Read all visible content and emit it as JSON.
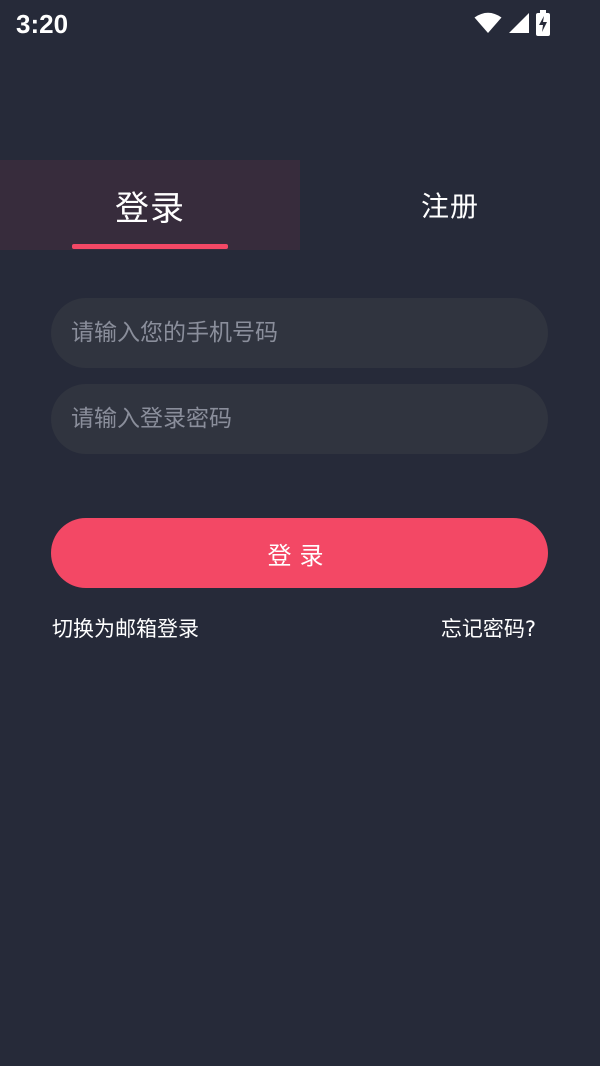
{
  "status_bar": {
    "time": "3:20",
    "icons": [
      "wifi-icon",
      "cellular-signal-icon",
      "battery-charging-icon"
    ]
  },
  "tabs": {
    "login_label": "登录",
    "register_label": "注册",
    "active": "login"
  },
  "form": {
    "phone_placeholder": "请输入您的手机号码",
    "password_placeholder": "请输入登录密码",
    "submit_label": "登录"
  },
  "links": {
    "switch_email": "切换为邮箱登录",
    "forgot_password": "忘记密码?"
  },
  "colors": {
    "background": "#262a39",
    "accent": "#f34865",
    "input_background": "#30343f",
    "active_tab_background": "#372c3c",
    "placeholder": "#8a8e9b"
  }
}
